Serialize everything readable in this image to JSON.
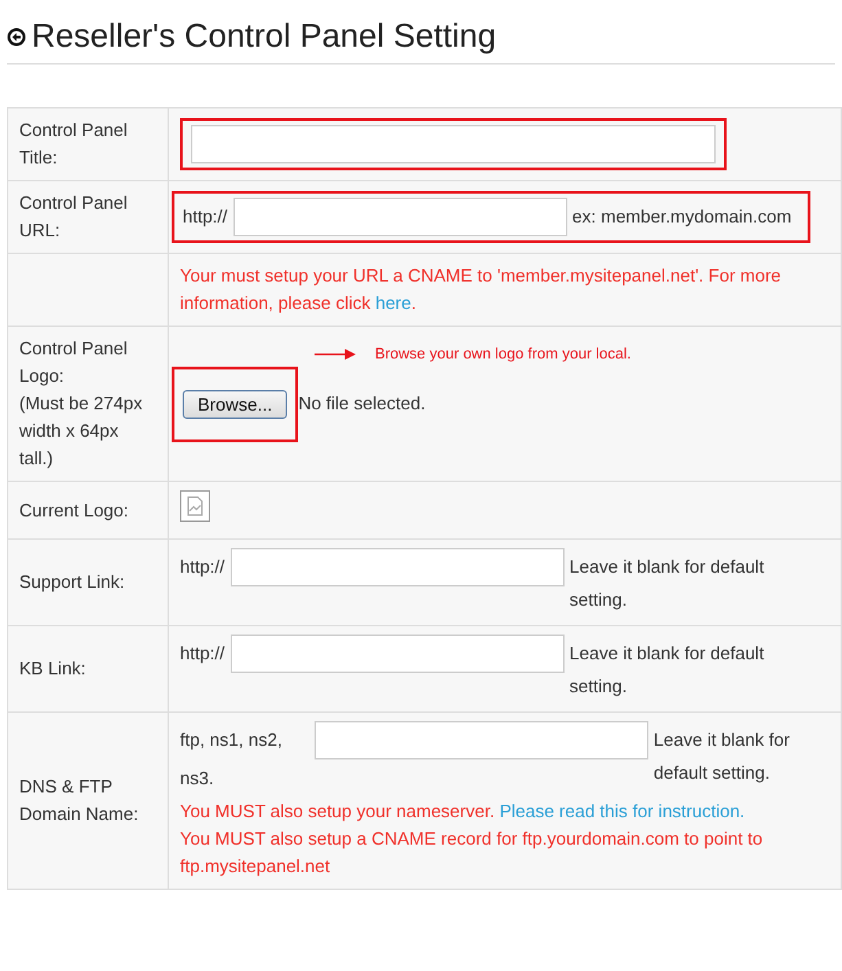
{
  "title": "Reseller's Control Panel Setting",
  "rows": [
    {
      "kind": "text",
      "label": "Control Panel Title:",
      "highlighted": true
    },
    {
      "kind": "url",
      "label": "Control Panel URL:",
      "prefix": "http://",
      "hint": "ex: member.mydomain.com",
      "highlighted": true
    },
    {
      "kind": "note",
      "text": "Your must setup your URL a CNAME to 'member.mysitepanel.net'. For more information, please click ",
      "link": "here",
      "after": "."
    },
    {
      "kind": "file",
      "label": "Control Panel Logo:",
      "sublabel": "(Must be 274px width x 64px tall.)",
      "button": "Browse...",
      "status": "No file selected.",
      "annotation": "Browse your own logo from your local.",
      "highlighted": true
    },
    {
      "kind": "image",
      "label": "Current Logo:"
    },
    {
      "kind": "url",
      "label": "Support Link:",
      "prefix": "http://",
      "hint": "Leave it blank for default setting.",
      "highlighted": false
    },
    {
      "kind": "url",
      "label": "KB Link:",
      "prefix": "http://",
      "hint": "Leave it blank for default setting.",
      "highlighted": false
    },
    {
      "kind": "dns",
      "label": "DNS & FTP Domain Name:",
      "prefix": "ftp, ns1, ns2, ns3.",
      "hint": "Leave it blank for default setting.",
      "notes": [
        {
          "text": "You MUST also setup your nameserver. ",
          "link": "Please read this for instruction."
        },
        {
          "text": "You MUST also setup a CNAME record for ftp.yourdomain.com to point to ftp.mysitepanel.net"
        }
      ]
    }
  ]
}
